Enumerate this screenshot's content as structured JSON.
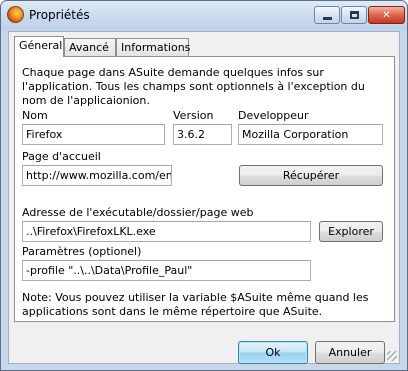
{
  "window": {
    "title": "Propriétés",
    "controls": {
      "minimize": "minimize",
      "maximize": "maximize",
      "close": "✕"
    }
  },
  "tabs": [
    {
      "label": "Géneral",
      "active": true
    },
    {
      "label": "Avancé",
      "active": false
    },
    {
      "label": "Informations",
      "active": false
    }
  ],
  "general": {
    "description": "Chaque page dans ASuite demande quelques infos sur l'application. Tous les champs sont optionnels à l'exception du nom de l'applicaionion.",
    "name_label": "Nom",
    "name_value": "Firefox",
    "version_label": "Version",
    "version_value": "3.6.2",
    "developer_label": "Developpeur",
    "developer_value": "Mozilla Corporation",
    "homepage_label": "Page d'accueil",
    "homepage_value": "http://www.mozilla.com/en-U",
    "retrieve_button": "Récupérer",
    "path_label": "Adresse de l'exécutable/dossier/page web",
    "path_value": "..\\Firefox\\FirefoxLKL.exe",
    "explore_button": "Explorer",
    "params_label": "Paramètres (optionel)",
    "params_value": "-profile \"..\\..\\Data\\Profile_Paul\"",
    "note": "Note: Vous pouvez utiliser la variable $ASuite même quand les applications sont dans le même répertoire que ASuite."
  },
  "footer": {
    "ok_button": "Ok",
    "cancel_button": "Annuler"
  },
  "icons": {
    "app": "firefox-icon"
  }
}
